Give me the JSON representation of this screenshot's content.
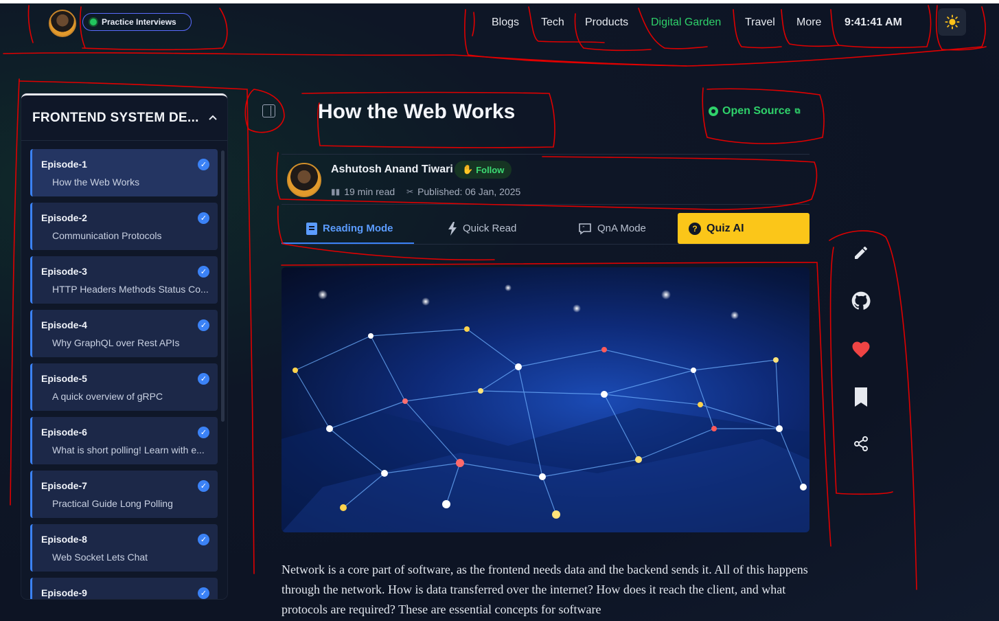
{
  "header": {
    "practice_label": "Practice Interviews",
    "nav": [
      {
        "label": "Blogs",
        "active": false
      },
      {
        "label": "Tech",
        "active": false
      },
      {
        "label": "Products",
        "active": false
      },
      {
        "label": "Digital Garden",
        "active": true
      },
      {
        "label": "Travel",
        "active": false
      },
      {
        "label": "More",
        "active": false
      }
    ],
    "clock": "9:41:41 AM",
    "theme_icon": "sun-icon"
  },
  "sidebar": {
    "title": "FRONTEND SYSTEM DE...",
    "episodes": [
      {
        "number": "Episode-1",
        "title": "How the Web Works",
        "completed": true
      },
      {
        "number": "Episode-2",
        "title": "Communication Protocols",
        "completed": true
      },
      {
        "number": "Episode-3",
        "title": "HTTP Headers Methods Status Co...",
        "completed": true
      },
      {
        "number": "Episode-4",
        "title": "Why GraphQL over Rest APIs",
        "completed": true
      },
      {
        "number": "Episode-5",
        "title": "A quick overview of gRPC",
        "completed": true
      },
      {
        "number": "Episode-6",
        "title": "What is short polling! Learn with e...",
        "completed": true
      },
      {
        "number": "Episode-7",
        "title": "Practical Guide Long Polling",
        "completed": true
      },
      {
        "number": "Episode-8",
        "title": "Web Socket Lets Chat",
        "completed": true
      },
      {
        "number": "Episode-9",
        "title": "",
        "completed": true
      }
    ]
  },
  "article": {
    "title": "How the Web Works",
    "open_source_label": "Open Source",
    "author": {
      "name": "Ashutosh Anand Tiwari",
      "follow_label": "Follow",
      "read_time": "19 min read",
      "published": "Published: 06 Jan, 2025"
    },
    "tabs": [
      {
        "label": "Reading Mode",
        "icon": "book-icon",
        "active": true
      },
      {
        "label": "Quick Read",
        "icon": "lightning-icon",
        "active": false
      },
      {
        "label": "QnA Mode",
        "icon": "chat-icon",
        "active": false
      },
      {
        "label": "Quiz AI",
        "icon": "question-icon",
        "active": false
      }
    ],
    "body": "Network is a core part of software, as the frontend needs data and the backend sends it. All of this happens through the network. How is data transferred over the internet? How does it reach the client, and what protocols are required? These are essential concepts for software"
  },
  "actions": [
    {
      "icon": "pencil-icon"
    },
    {
      "icon": "github-icon"
    },
    {
      "icon": "heart-icon"
    },
    {
      "icon": "bookmark-icon"
    },
    {
      "icon": "share-icon"
    }
  ],
  "colors": {
    "accent_green": "#2fd16a",
    "accent_blue": "#3b82f6",
    "quiz_yellow": "#fbc619",
    "heart_red": "#ef4444",
    "annotation_red": "#e00000"
  }
}
